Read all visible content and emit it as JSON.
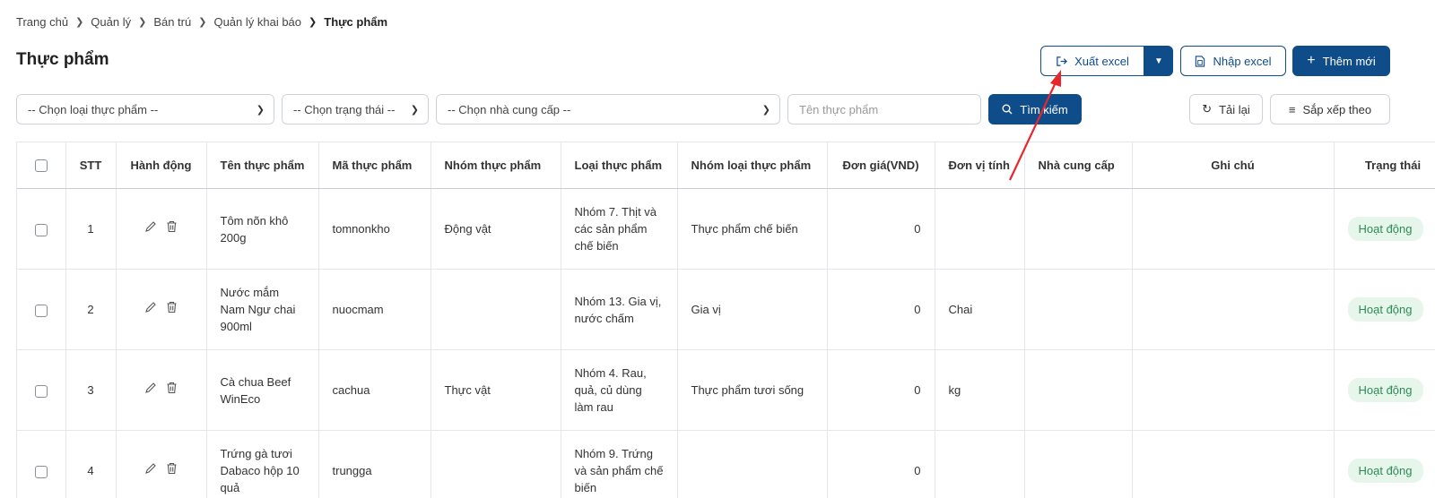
{
  "breadcrumb": [
    "Trang chủ",
    "Quản lý",
    "Bán trú",
    "Quản lý khai báo",
    "Thực phẩm"
  ],
  "page_title": "Thực phẩm",
  "toolbar": {
    "export_label": "Xuất excel",
    "import_label": "Nhập excel",
    "add_label": "Thêm mới",
    "search_label": "Tìm kiếm",
    "reload_label": "Tải lại",
    "sort_label": "Sắp xếp theo"
  },
  "filters": {
    "food_type": "-- Chọn loại thực phẩm --",
    "status": "-- Chọn trạng thái --",
    "supplier": "-- Chọn nhà cung cấp --",
    "name_placeholder": "Tên thực phẩm"
  },
  "table": {
    "columns": [
      "STT",
      "Hành động",
      "Tên thực phẩm",
      "Mã thực phẩm",
      "Nhóm thực phẩm",
      "Loại thực phẩm",
      "Nhóm loại thực phẩm",
      "Đơn giá(VND)",
      "Đơn vị tính",
      "Nhà cung cấp",
      "Ghi chú",
      "Trạng thái"
    ],
    "rows": [
      {
        "stt": "1",
        "name": "Tôm nõn khô 200g",
        "code": "tomnonkho",
        "group": "Động vật",
        "type": "Nhóm 7. Thịt và các sản phẩm chế biến",
        "type_group": "Thực phẩm chế biến",
        "price": "0",
        "unit": "",
        "supplier": "",
        "note": "",
        "status": "Hoạt động"
      },
      {
        "stt": "2",
        "name": "Nước mắm Nam Ngư chai 900ml",
        "code": "nuocmam",
        "group": "",
        "type": "Nhóm 13. Gia vị, nước chấm",
        "type_group": "Gia vị",
        "price": "0",
        "unit": "Chai",
        "supplier": "",
        "note": "",
        "status": "Hoạt động"
      },
      {
        "stt": "3",
        "name": "Cà chua Beef WinEco",
        "code": "cachua",
        "group": "Thực vật",
        "type": "Nhóm 4. Rau, quả, củ dùng làm rau",
        "type_group": "Thực phẩm tươi sống",
        "price": "0",
        "unit": "kg",
        "supplier": "",
        "note": "",
        "status": "Hoạt động"
      },
      {
        "stt": "4",
        "name": "Trứng gà tươi Dabaco hộp 10 quả",
        "code": "trungga",
        "group": "",
        "type": "Nhóm 9. Trứng và sản phẩm chế biến",
        "type_group": "",
        "price": "0",
        "unit": "",
        "supplier": "",
        "note": "",
        "status": "Hoạt động"
      }
    ]
  },
  "colors": {
    "primary": "#0f4c8a",
    "badge_bg": "#e6f6ea",
    "badge_text": "#2e8b57",
    "annotation": "#e8262b"
  }
}
